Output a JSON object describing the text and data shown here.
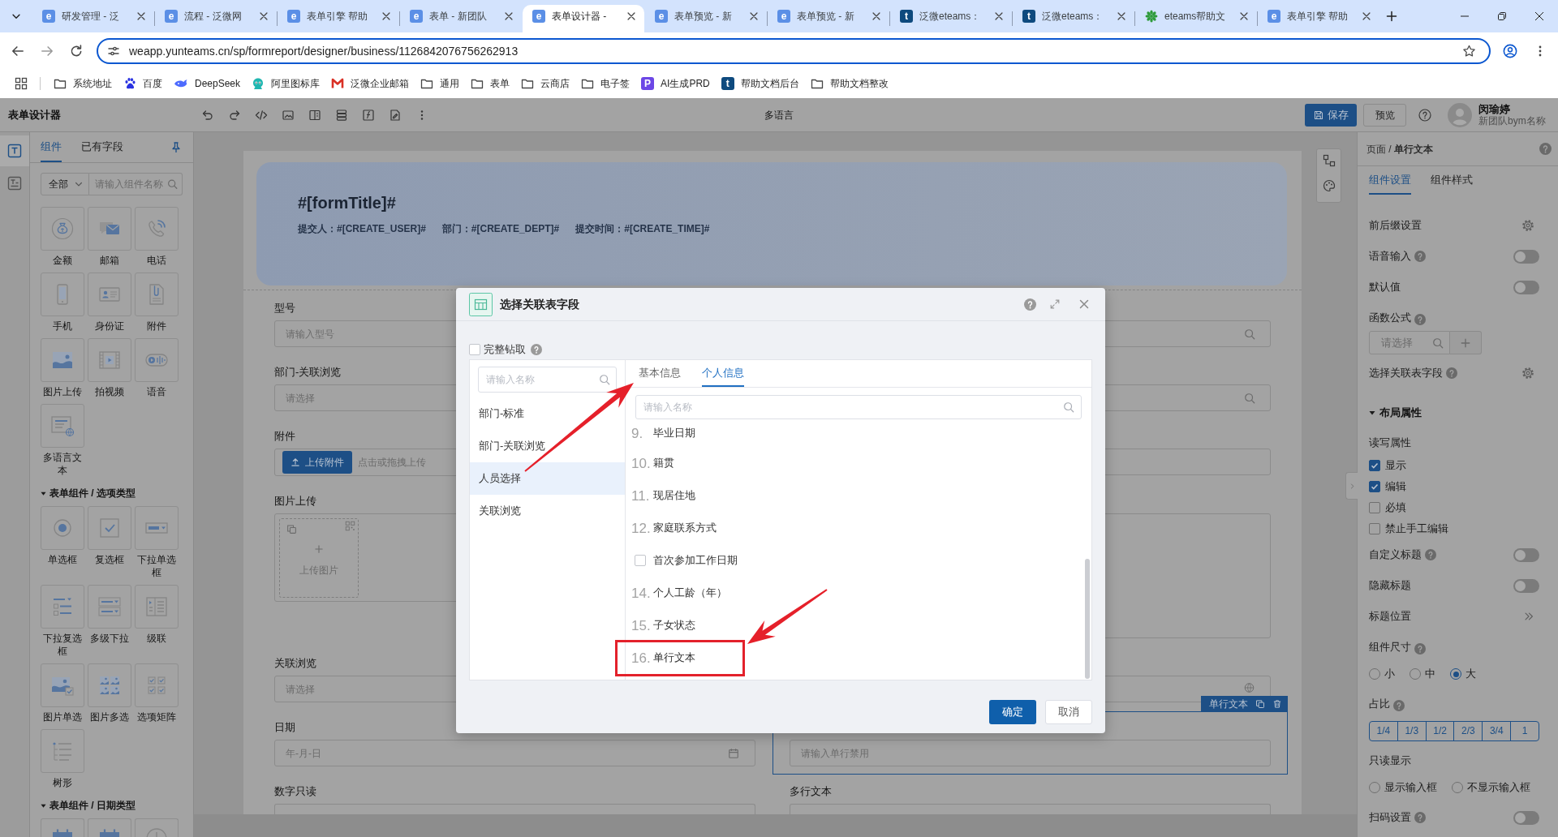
{
  "browser": {
    "tabs": [
      {
        "title": "研发管理 - 泛",
        "favicon": {
          "kind": "letter",
          "letter": "e",
          "color": "#5b8fe6"
        },
        "selected": false
      },
      {
        "title": "流程 - 泛微网",
        "favicon": {
          "kind": "letter",
          "letter": "e",
          "color": "#5b8fe6"
        },
        "selected": false
      },
      {
        "title": "表单引擎 帮助",
        "favicon": {
          "kind": "letter",
          "letter": "e",
          "color": "#5b8fe6"
        },
        "selected": false
      },
      {
        "title": "表单 - 新团队",
        "favicon": {
          "kind": "letter",
          "letter": "e",
          "color": "#5b8fe6"
        },
        "selected": false
      },
      {
        "title": "表单设计器 -",
        "favicon": {
          "kind": "letter",
          "letter": "e",
          "color": "#5b8fe6"
        },
        "selected": true
      },
      {
        "title": "表单预览 - 新",
        "favicon": {
          "kind": "letter",
          "letter": "e",
          "color": "#5b8fe6"
        },
        "selected": false
      },
      {
        "title": "表单预览 - 新",
        "favicon": {
          "kind": "letter",
          "letter": "e",
          "color": "#5b8fe6"
        },
        "selected": false
      },
      {
        "title": "泛微eteams：",
        "favicon": {
          "kind": "letter",
          "letter": "t",
          "color": "#0e4a7e"
        },
        "selected": false
      },
      {
        "title": "泛微eteams：",
        "favicon": {
          "kind": "letter",
          "letter": "t",
          "color": "#0e4a7e"
        },
        "selected": false
      },
      {
        "title": "eteams帮助文",
        "favicon": {
          "kind": "leaf"
        },
        "selected": false
      },
      {
        "title": "表单引擎 帮助",
        "favicon": {
          "kind": "letter",
          "letter": "e",
          "color": "#5b8fe6"
        },
        "selected": false
      }
    ],
    "address": "weapp.yunteams.cn/sp/formreport/designer/business/1126842076756262913",
    "bookmarks": [
      {
        "label": "系统地址",
        "icon": {
          "kind": "folder"
        }
      },
      {
        "label": "百度",
        "icon": {
          "kind": "paw"
        }
      },
      {
        "label": "DeepSeek",
        "icon": {
          "kind": "whale"
        }
      },
      {
        "label": "阿里图标库",
        "icon": {
          "kind": "mascot"
        }
      },
      {
        "label": "泛微企业邮箱",
        "icon": {
          "kind": "mlogo"
        }
      },
      {
        "label": "通用",
        "icon": {
          "kind": "folder"
        }
      },
      {
        "label": "表单",
        "icon": {
          "kind": "folder"
        }
      },
      {
        "label": "云商店",
        "icon": {
          "kind": "folder"
        }
      },
      {
        "label": "电子签",
        "icon": {
          "kind": "folder"
        }
      },
      {
        "label": "AI生成PRD",
        "icon": {
          "kind": "letter",
          "letter": "P",
          "color": "#6c47e6"
        }
      },
      {
        "label": "帮助文档后台",
        "icon": {
          "kind": "letter",
          "letter": "t",
          "color": "#0e4a7e"
        }
      },
      {
        "label": "帮助文档整改",
        "icon": {
          "kind": "folder"
        }
      }
    ]
  },
  "designer": {
    "title": "表单设计器",
    "toolbar_title": "多语言",
    "save": "保存",
    "preview": "预览",
    "user": {
      "name": "闵瑜婷",
      "team": "新团队bym名称"
    }
  },
  "left_panel": {
    "rail": [
      {
        "kind": "text",
        "selected": true
      },
      {
        "kind": "paragraph",
        "selected": false
      }
    ],
    "tabs": [
      {
        "label": "组件",
        "selected": true
      },
      {
        "label": "已有字段",
        "selected": false
      }
    ],
    "filter": {
      "value": "全部",
      "placeholder": "请输入组件名称"
    },
    "groups": [
      {
        "items": [
          {
            "kind": "money",
            "label": "金额"
          },
          {
            "kind": "mail",
            "label": "邮箱"
          },
          {
            "kind": "phone",
            "label": "电话"
          },
          {
            "kind": "mobile",
            "label": "手机"
          },
          {
            "kind": "idcard",
            "label": "身份证"
          },
          {
            "kind": "attachment",
            "label": "附件"
          },
          {
            "kind": "image",
            "label": "图片上传"
          },
          {
            "kind": "video",
            "label": "拍视频"
          },
          {
            "kind": "voice",
            "label": "语音"
          },
          {
            "kind": "multilang",
            "label": "多语言文本"
          }
        ]
      },
      {
        "title": "表单组件 / 选项类型",
        "expanded": true,
        "items": [
          {
            "kind": "radio",
            "label": "单选框"
          },
          {
            "kind": "checkbox",
            "label": "复选框"
          },
          {
            "kind": "select",
            "label": "下拉单选框"
          },
          {
            "kind": "multiselect",
            "label": "下拉复选框"
          },
          {
            "kind": "multilevel",
            "label": "多级下拉"
          },
          {
            "kind": "cascade",
            "label": "级联"
          },
          {
            "kind": "imageradio",
            "label": "图片单选"
          },
          {
            "kind": "imagemulti",
            "label": "图片多选"
          },
          {
            "kind": "matrix",
            "label": "选项矩阵"
          },
          {
            "kind": "tree",
            "label": "树形"
          }
        ]
      },
      {
        "title": "表单组件 / 日期类型",
        "expanded": true,
        "items": [
          {
            "kind": "date"
          },
          {
            "kind": "datetime"
          },
          {
            "kind": "time"
          }
        ]
      }
    ]
  },
  "form": {
    "title": "#[formTitle]#",
    "meta": [
      "提交人：#[CREATE_USER]#",
      "部门：#[CREATE_DEPT]#",
      "提交时间：#[CREATE_TIME]#"
    ],
    "rows": [
      {
        "left": {
          "kind": "input",
          "label": "型号",
          "placeholder": "请输入型号",
          "selected": false
        },
        "right": {
          "kind": "search",
          "selected": false
        }
      },
      {
        "left": {
          "kind": "input",
          "label": "部门-关联浏览",
          "placeholder": "请选择",
          "selected": false
        },
        "right": {
          "kind": "search",
          "selected": false
        }
      },
      {
        "left": {
          "kind": "upload",
          "label": "附件",
          "button": "上传附件",
          "hint": "点击或拖拽上传",
          "selected": false
        },
        "right": {
          "kind": "input",
          "selected": false
        }
      },
      {
        "left": {
          "kind": "image-upload",
          "label": "图片上传",
          "hint": "上传图片",
          "selected": false
        },
        "right": {
          "kind": "textarea",
          "selected": false
        }
      },
      {
        "left": {
          "kind": "input",
          "label": "关联浏览",
          "placeholder": "请选择",
          "selected": false
        },
        "right": {
          "kind": "globe",
          "selected": false
        }
      },
      {
        "left": {
          "kind": "date",
          "label": "日期",
          "placeholder": "年-月-日",
          "selected": false
        },
        "right": {
          "kind": "input",
          "placeholder": "请输入单行禁用",
          "selected": true,
          "tag": "单行文本"
        }
      },
      {
        "left": {
          "kind": "input",
          "label": "数字只读",
          "selected": false
        },
        "right": {
          "kind": "textarea",
          "label": "多行文本",
          "selected": false
        }
      }
    ]
  },
  "dialog": {
    "title": "选择关联表字段",
    "full_drill": {
      "label": "完整钻取",
      "checked": false,
      "help": true
    },
    "left_search": {
      "placeholder": "请输入名称"
    },
    "sources": [
      {
        "label": "部门-标准",
        "selected": false
      },
      {
        "label": "部门-关联浏览",
        "selected": false
      },
      {
        "label": "人员选择",
        "selected": true
      },
      {
        "label": "关联浏览",
        "selected": false
      }
    ],
    "tabs": [
      {
        "label": "基本信息",
        "selected": false
      },
      {
        "label": "个人信息",
        "selected": true
      }
    ],
    "search": {
      "placeholder": "请输入名称"
    },
    "fields": [
      {
        "kind": "numbered",
        "number": "9.",
        "label": "毕业日期",
        "highlighted": false
      },
      {
        "kind": "numbered",
        "number": "10.",
        "label": "籍贯",
        "highlighted": false
      },
      {
        "kind": "numbered",
        "number": "11.",
        "label": "现居住地",
        "highlighted": false
      },
      {
        "kind": "numbered",
        "number": "12.",
        "label": "家庭联系方式",
        "highlighted": false
      },
      {
        "kind": "checkbox",
        "label": "首次参加工作日期",
        "checked": false,
        "highlighted": false
      },
      {
        "kind": "numbered",
        "number": "14.",
        "label": "个人工龄（年）",
        "highlighted": false
      },
      {
        "kind": "numbered",
        "number": "15.",
        "label": "子女状态",
        "highlighted": false
      },
      {
        "kind": "numbered",
        "number": "16.",
        "label": "单行文本",
        "highlighted": true
      }
    ],
    "buttons": [
      {
        "label": "确定",
        "kind": "primary"
      },
      {
        "label": "取消",
        "kind": "default"
      }
    ]
  },
  "properties": {
    "breadcrumb": "页面 / **单行文本**",
    "tabs": [
      {
        "label": "组件设置",
        "selected": true
      },
      {
        "label": "组件样式",
        "selected": false
      }
    ],
    "rows": [
      {
        "kind": "gear",
        "label": "前后缀设置"
      },
      {
        "kind": "toggle",
        "label": "语音输入",
        "help": true,
        "on": false
      },
      {
        "kind": "toggle",
        "label": "默认值",
        "on": false
      },
      {
        "kind": "caption",
        "label": "函数公式",
        "help": true
      },
      {
        "kind": "formula",
        "placeholder": "请选择"
      },
      {
        "kind": "gear",
        "label": "选择关联表字段",
        "help": true
      },
      {
        "kind": "section",
        "label": "布局属性",
        "expanded": true
      },
      {
        "kind": "caption",
        "label": "读写属性"
      },
      {
        "kind": "checkbox",
        "label": "显示",
        "checked": true
      },
      {
        "kind": "checkbox",
        "label": "编辑",
        "checked": true
      },
      {
        "kind": "checkbox",
        "label": "必填",
        "checked": false
      },
      {
        "kind": "checkbox",
        "label": "禁止手工编辑",
        "checked": false
      },
      {
        "kind": "toggle",
        "label": "自定义标题",
        "help": true,
        "on": false
      },
      {
        "kind": "toggle",
        "label": "隐藏标题",
        "on": false
      },
      {
        "kind": "link",
        "label": "标题位置"
      },
      {
        "kind": "caption",
        "label": "组件尺寸",
        "help": true
      },
      {
        "kind": "radios",
        "options": [
          {
            "label": "小",
            "selected": false
          },
          {
            "label": "中",
            "selected": false
          },
          {
            "label": "大",
            "selected": true
          }
        ]
      },
      {
        "kind": "caption",
        "label": "占比",
        "help": true
      },
      {
        "kind": "segmented",
        "options": [
          {
            "label": "1/4",
            "selected": false
          },
          {
            "label": "1/3",
            "selected": false
          },
          {
            "label": "1/2",
            "selected": false
          },
          {
            "label": "2/3",
            "selected": false
          },
          {
            "label": "3/4",
            "selected": false
          },
          {
            "label": "1",
            "selected": false
          }
        ]
      },
      {
        "kind": "caption",
        "label": "只读显示"
      },
      {
        "kind": "radios",
        "options": [
          {
            "label": "显示输入框",
            "selected": false
          },
          {
            "label": "不显示输入框",
            "selected": false
          }
        ]
      },
      {
        "kind": "toggle",
        "label": "扫码设置",
        "help": true,
        "on": false
      }
    ]
  }
}
